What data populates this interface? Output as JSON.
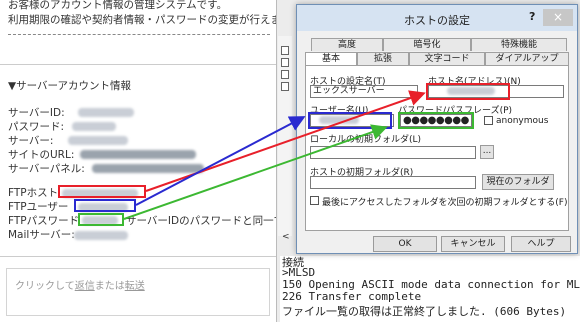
{
  "email": {
    "intro_line1": "お客様のアカウント情報の管理システムです。",
    "intro_line2": "利用期限の確認や契約者情報・パスワードの変更が行えます。",
    "section_heading": "▼サーバーアカウント情報",
    "fields": {
      "server_id": "サーバーID:",
      "password": "パスワード:",
      "server": "サーバー:",
      "site_url": "サイトのURL:",
      "server_panel": "サーバーパネル:",
      "ftp_host": "FTPホスト",
      "ftp_user": "FTPユーザー",
      "ftp_password": "FTPパスワード",
      "ftp_password_note": "サーバーIDのパスワードと同一です)",
      "mail_server": "Mailサーバー:"
    },
    "reply_prefix": "クリックして",
    "reply_link": "返信",
    "reply_middle": "または",
    "forward_link": "転送"
  },
  "log": {
    "lines": [
      "接続",
      ">MLSD",
      "150 Opening ASCII mode data connection for MLSD",
      "226 Transfer complete",
      "ファイル一覧の取得は正常終了しました. (606 Bytes)"
    ]
  },
  "dialog": {
    "title": "ホストの設定",
    "help_label": "?",
    "close_label": "×",
    "tabs_row1": [
      "高度",
      "暗号化",
      "特殊機能"
    ],
    "tabs_row2": [
      "基本",
      "拡張",
      "文字コード",
      "ダイアルアップ"
    ],
    "active_tab": "基本",
    "host_name_label": "ホストの設定名(T)",
    "host_name_value": "エックスサーバー",
    "host_address_label": "ホスト名(アドレス)(N)",
    "username_label": "ユーザー名(U)",
    "password_label": "パスワード/パスフレーズ(P)",
    "password_value": "●●●●●●●●",
    "anonymous_label": "anonymous",
    "local_folder_label": "ローカルの初期フォルダ(L)",
    "browse_label": "...",
    "host_folder_label": "ホストの初期フォルダ(R)",
    "current_folder_button": "現在のフォルダ",
    "last_folder_label": "最後にアクセスしたフォルダを次回の初期フォルダとする(F)",
    "ok_button": "OK",
    "cancel_button": "キャンセル",
    "help_button": "ヘルプ"
  },
  "annotation_colors": {
    "host": "#e8202a",
    "user": "#2a2ad0",
    "password": "#3cb832"
  }
}
